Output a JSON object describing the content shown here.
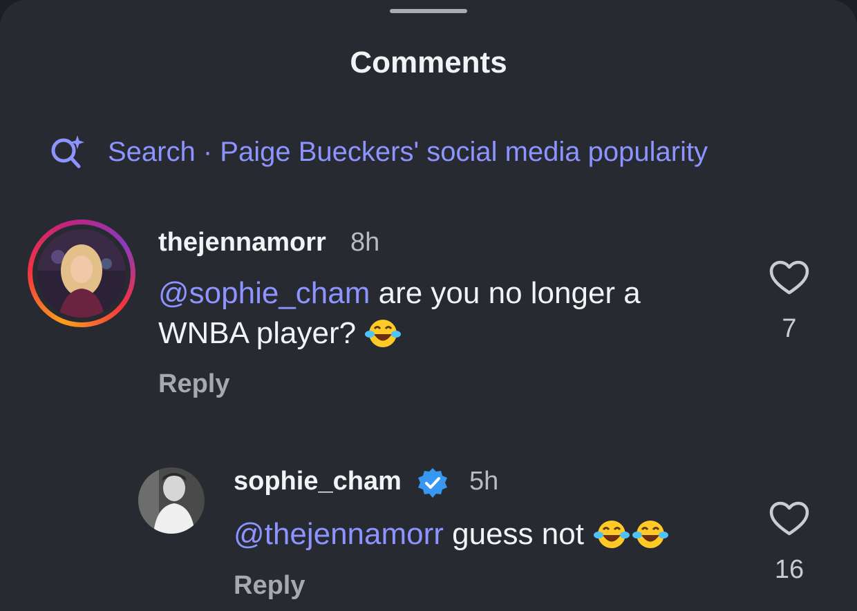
{
  "sheet": {
    "title": "Comments"
  },
  "search": {
    "icon": "ai-search-icon",
    "label": "Search · Paige Bueckers' social media popularity"
  },
  "comments": [
    {
      "username": "thejennamorr",
      "time": "8h",
      "mention": "@sophie_cham",
      "text_line1": " are you no longer a",
      "text_line2": "WNBA player?",
      "emoji": "face-with-tears-of-joy",
      "reply_label": "Reply",
      "likes": "7",
      "has_story_ring": true
    },
    {
      "username": "sophie_cham",
      "verified": true,
      "time": "5h",
      "mention": "@thejennamorr",
      "text": " guess not",
      "emoji": "face-with-tears-of-joy x2",
      "reply_label": "Reply",
      "likes": "16"
    }
  ],
  "colors": {
    "background": "#272a31",
    "mention": "#8d94ff",
    "verified": "#3897f0"
  }
}
